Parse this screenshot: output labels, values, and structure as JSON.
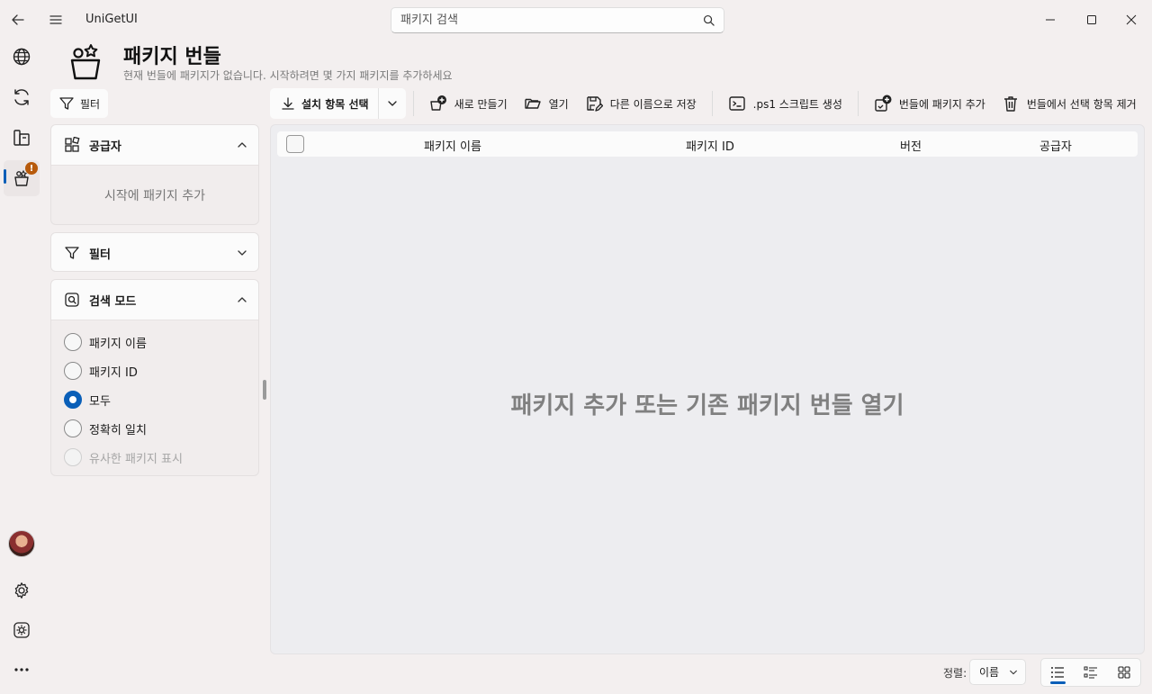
{
  "app": {
    "title": "UniGetUI",
    "search_placeholder": "패키지 검색"
  },
  "header": {
    "title": "패키지 번들",
    "subtitle": "현재 번들에 패키지가 없습니다. 시작하려면 몇 가지 패키지를 추가하세요"
  },
  "filter_button": {
    "label": "필터"
  },
  "toolbar": {
    "install_selected": "설치 항목 선택",
    "new": "새로 만들기",
    "open": "열기",
    "save_as": "다른 이름으로 저장",
    "ps1": ".ps1 스크립트 생성",
    "add_to_bundle": "번들에 패키지 추가",
    "remove_selected": "번들에서 선택 항목 제거"
  },
  "panels": {
    "sources": {
      "title": "공급자",
      "empty": "시작에 패키지 추가"
    },
    "filters": {
      "title": "필터"
    },
    "search_mode": {
      "title": "검색 모드",
      "options": [
        {
          "label": "패키지 이름",
          "checked": false,
          "disabled": false
        },
        {
          "label": "패키지 ID",
          "checked": false,
          "disabled": false
        },
        {
          "label": "모두",
          "checked": true,
          "disabled": false
        },
        {
          "label": "정확히 일치",
          "checked": false,
          "disabled": false
        },
        {
          "label": "유사한 패키지 표시",
          "checked": false,
          "disabled": true
        }
      ]
    }
  },
  "table": {
    "columns": [
      "패키지 이름",
      "패키지 ID",
      "버전",
      "공급자"
    ],
    "empty_message": "패키지 추가 또는 기존 패키지 번들 열기"
  },
  "footer": {
    "sort_label": "정렬:",
    "sort_value": "이름"
  },
  "nav": {
    "badge": "!"
  },
  "colors": {
    "accent": "#0a5fb8",
    "badge": "#b75a0b"
  }
}
